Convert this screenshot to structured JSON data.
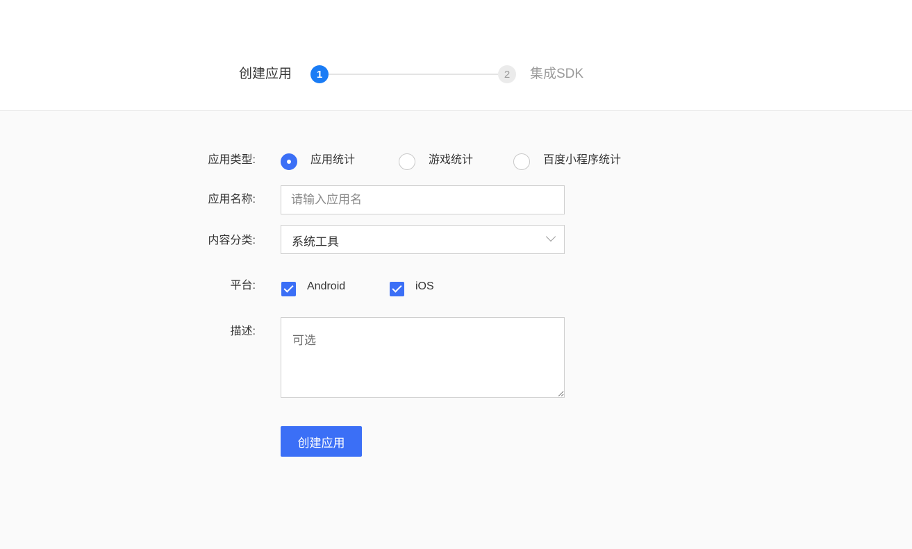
{
  "steps": [
    {
      "number": "1",
      "label": "创建应用",
      "status": "active"
    },
    {
      "number": "2",
      "label": "集成SDK",
      "status": "inactive"
    }
  ],
  "form": {
    "app_type": {
      "label": "应用类型:",
      "options": [
        {
          "label": "应用统计",
          "checked": true
        },
        {
          "label": "游戏统计",
          "checked": false
        },
        {
          "label": "百度小程序统计",
          "checked": false
        }
      ]
    },
    "app_name": {
      "label": "应用名称:",
      "value": "",
      "placeholder": "请输入应用名"
    },
    "category": {
      "label": "内容分类:",
      "value": "系统工具"
    },
    "platform": {
      "label": "平台:",
      "options": [
        {
          "label": "Android",
          "checked": true
        },
        {
          "label": "iOS",
          "checked": true
        }
      ]
    },
    "description": {
      "label": "描述:",
      "value": "",
      "placeholder": "可选"
    },
    "submit_label": "创建应用"
  },
  "colors": {
    "primary": "#3b6ff6",
    "step_active": "#1a7cf5",
    "background": "#fafafa"
  }
}
